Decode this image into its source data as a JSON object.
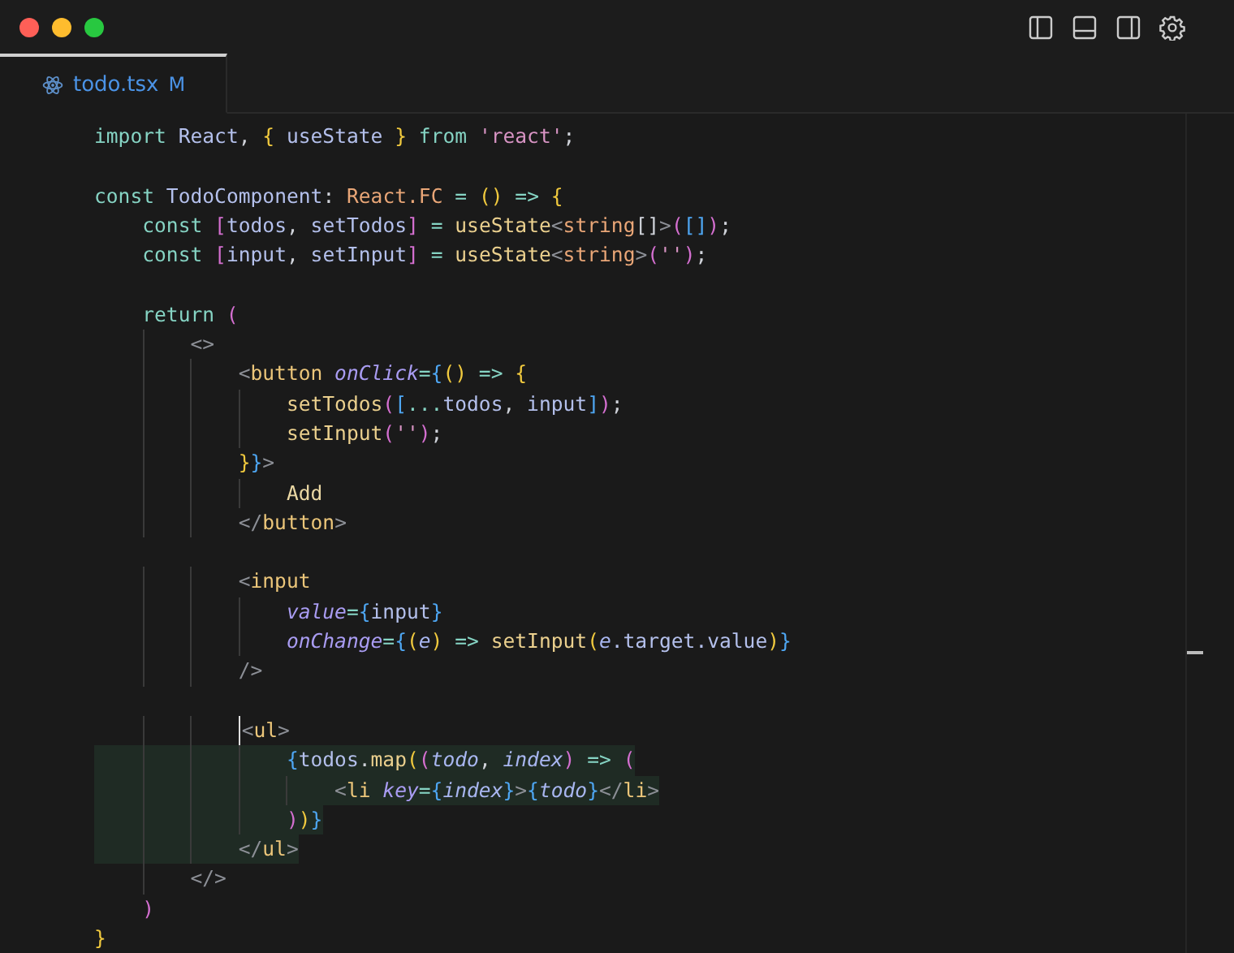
{
  "tabs": [
    {
      "label": "todo.tsx",
      "badge": "M",
      "selected": true
    }
  ],
  "editor": {
    "lines": [
      {
        "kind": "code",
        "tokens": [
          {
            "kind": "kw",
            "text": "import"
          },
          {
            "kind": "var",
            "text": " React"
          },
          {
            "kind": "plain",
            "text": ", "
          },
          {
            "kind": "p1",
            "text": "{"
          },
          {
            "kind": "var",
            "text": " useState "
          },
          {
            "kind": "p1",
            "text": "}"
          },
          {
            "kind": "kw",
            "text": " from "
          },
          {
            "kind": "str",
            "text": "'react'"
          },
          {
            "kind": "plain",
            "text": ";"
          }
        ]
      },
      {
        "kind": "blank"
      },
      {
        "kind": "code",
        "tokens": [
          {
            "kind": "kw",
            "text": "const"
          },
          {
            "kind": "var",
            "text": " TodoComponent"
          },
          {
            "kind": "plain",
            "text": ": "
          },
          {
            "kind": "type",
            "text": "React.FC"
          },
          {
            "kind": "op",
            "text": " = "
          },
          {
            "kind": "p1",
            "text": "()"
          },
          {
            "kind": "op",
            "text": " => "
          },
          {
            "kind": "p1",
            "text": "{"
          }
        ]
      },
      {
        "kind": "code",
        "tokens": [
          {
            "kind": "kw",
            "text": "    const"
          },
          {
            "kind": "p2",
            "text": " ["
          },
          {
            "kind": "var",
            "text": "todos"
          },
          {
            "kind": "plain",
            "text": ", "
          },
          {
            "kind": "var",
            "text": "setTodos"
          },
          {
            "kind": "p2",
            "text": "]"
          },
          {
            "kind": "op",
            "text": " = "
          },
          {
            "kind": "fn",
            "text": "useState"
          },
          {
            "kind": "punct",
            "text": "<"
          },
          {
            "kind": "type",
            "text": "string"
          },
          {
            "kind": "plain",
            "text": "[]"
          },
          {
            "kind": "punct",
            "text": ">"
          },
          {
            "kind": "p2",
            "text": "("
          },
          {
            "kind": "p3",
            "text": "[]"
          },
          {
            "kind": "p2",
            "text": ")"
          },
          {
            "kind": "plain",
            "text": ";"
          }
        ]
      },
      {
        "kind": "code",
        "tokens": [
          {
            "kind": "kw",
            "text": "    const"
          },
          {
            "kind": "p2",
            "text": " ["
          },
          {
            "kind": "var",
            "text": "input"
          },
          {
            "kind": "plain",
            "text": ", "
          },
          {
            "kind": "var",
            "text": "setInput"
          },
          {
            "kind": "p2",
            "text": "]"
          },
          {
            "kind": "op",
            "text": " = "
          },
          {
            "kind": "fn",
            "text": "useState"
          },
          {
            "kind": "punct",
            "text": "<"
          },
          {
            "kind": "type",
            "text": "string"
          },
          {
            "kind": "punct",
            "text": ">"
          },
          {
            "kind": "p2",
            "text": "("
          },
          {
            "kind": "str",
            "text": "''"
          },
          {
            "kind": "p2",
            "text": ")"
          },
          {
            "kind": "plain",
            "text": ";"
          }
        ]
      },
      {
        "kind": "blank"
      },
      {
        "kind": "code",
        "tokens": [
          {
            "kind": "kw",
            "text": "    return"
          },
          {
            "kind": "p2",
            "text": " ("
          }
        ]
      },
      {
        "kind": "code",
        "tokens": [
          {
            "kind": "punct",
            "text": "        <>"
          }
        ]
      },
      {
        "kind": "code",
        "tokens": [
          {
            "kind": "punct",
            "text": "            <"
          },
          {
            "kind": "tag",
            "text": "button"
          },
          {
            "kind": "attr",
            "text": " onClick"
          },
          {
            "kind": "op",
            "text": "="
          },
          {
            "kind": "p3",
            "text": "{"
          },
          {
            "kind": "p1",
            "text": "()"
          },
          {
            "kind": "op",
            "text": " => "
          },
          {
            "kind": "p1",
            "text": "{"
          }
        ]
      },
      {
        "kind": "code",
        "tokens": [
          {
            "kind": "fn",
            "text": "                setTodos"
          },
          {
            "kind": "p2",
            "text": "("
          },
          {
            "kind": "p3",
            "text": "["
          },
          {
            "kind": "op",
            "text": "..."
          },
          {
            "kind": "var",
            "text": "todos"
          },
          {
            "kind": "plain",
            "text": ", "
          },
          {
            "kind": "var",
            "text": "input"
          },
          {
            "kind": "p3",
            "text": "]"
          },
          {
            "kind": "p2",
            "text": ")"
          },
          {
            "kind": "plain",
            "text": ";"
          }
        ]
      },
      {
        "kind": "code",
        "tokens": [
          {
            "kind": "fn",
            "text": "                setInput"
          },
          {
            "kind": "p2",
            "text": "("
          },
          {
            "kind": "str",
            "text": "''"
          },
          {
            "kind": "p2",
            "text": ")"
          },
          {
            "kind": "plain",
            "text": ";"
          }
        ]
      },
      {
        "kind": "code",
        "tokens": [
          {
            "kind": "p1",
            "text": "            }"
          },
          {
            "kind": "p3",
            "text": "}"
          },
          {
            "kind": "punct",
            "text": ">"
          }
        ]
      },
      {
        "kind": "code",
        "tokens": [
          {
            "kind": "text",
            "text": "                Add"
          }
        ]
      },
      {
        "kind": "code",
        "tokens": [
          {
            "kind": "punct",
            "text": "            </"
          },
          {
            "kind": "tag",
            "text": "button"
          },
          {
            "kind": "punct",
            "text": ">"
          }
        ]
      },
      {
        "kind": "blank"
      },
      {
        "kind": "code",
        "tokens": [
          {
            "kind": "punct",
            "text": "            <"
          },
          {
            "kind": "tag",
            "text": "input"
          }
        ]
      },
      {
        "kind": "code",
        "tokens": [
          {
            "kind": "attr",
            "text": "                value"
          },
          {
            "kind": "op",
            "text": "="
          },
          {
            "kind": "p3",
            "text": "{"
          },
          {
            "kind": "var",
            "text": "input"
          },
          {
            "kind": "p3",
            "text": "}"
          }
        ]
      },
      {
        "kind": "code",
        "tokens": [
          {
            "kind": "attr",
            "text": "                onChange"
          },
          {
            "kind": "op",
            "text": "="
          },
          {
            "kind": "p3",
            "text": "{"
          },
          {
            "kind": "p1",
            "text": "("
          },
          {
            "kind": "param",
            "text": "e"
          },
          {
            "kind": "p1",
            "text": ")"
          },
          {
            "kind": "op",
            "text": " => "
          },
          {
            "kind": "fn",
            "text": "setInput"
          },
          {
            "kind": "p1",
            "text": "("
          },
          {
            "kind": "param",
            "text": "e"
          },
          {
            "kind": "var",
            "text": ".target.value"
          },
          {
            "kind": "p1",
            "text": ")"
          },
          {
            "kind": "p3",
            "text": "}"
          }
        ]
      },
      {
        "kind": "code",
        "tokens": [
          {
            "kind": "punct",
            "text": "            />"
          }
        ]
      },
      {
        "kind": "blank"
      },
      {
        "kind": "code",
        "cursor": true,
        "tokens": [
          {
            "kind": "punct",
            "text": "            <"
          },
          {
            "kind": "tag",
            "text": "ul"
          },
          {
            "kind": "punct",
            "text": ">"
          }
        ]
      },
      {
        "kind": "code",
        "selected": true,
        "tokens": [
          {
            "kind": "p3",
            "text": "                {"
          },
          {
            "kind": "var",
            "text": "todos"
          },
          {
            "kind": "plain",
            "text": "."
          },
          {
            "kind": "fn",
            "text": "map"
          },
          {
            "kind": "p1",
            "text": "("
          },
          {
            "kind": "p2",
            "text": "("
          },
          {
            "kind": "param",
            "text": "todo"
          },
          {
            "kind": "plain",
            "text": ", "
          },
          {
            "kind": "param",
            "text": "index"
          },
          {
            "kind": "p2",
            "text": ")"
          },
          {
            "kind": "op",
            "text": " => "
          },
          {
            "kind": "p2",
            "text": "("
          }
        ]
      },
      {
        "kind": "code",
        "selected": true,
        "tokens": [
          {
            "kind": "punct",
            "text": "                    <"
          },
          {
            "kind": "tag",
            "text": "li"
          },
          {
            "kind": "attr",
            "text": " key"
          },
          {
            "kind": "op",
            "text": "="
          },
          {
            "kind": "p3",
            "text": "{"
          },
          {
            "kind": "param",
            "text": "index"
          },
          {
            "kind": "p3",
            "text": "}"
          },
          {
            "kind": "punct",
            "text": ">"
          },
          {
            "kind": "p3",
            "text": "{"
          },
          {
            "kind": "param",
            "text": "todo"
          },
          {
            "kind": "p3",
            "text": "}"
          },
          {
            "kind": "punct",
            "text": "</"
          },
          {
            "kind": "tag",
            "text": "li"
          },
          {
            "kind": "punct",
            "text": ">"
          }
        ]
      },
      {
        "kind": "code",
        "selected": true,
        "tokens": [
          {
            "kind": "p2",
            "text": "                )"
          },
          {
            "kind": "p1",
            "text": ")"
          },
          {
            "kind": "p3",
            "text": "}"
          }
        ]
      },
      {
        "kind": "code",
        "selected": true,
        "tokens": [
          {
            "kind": "punct",
            "text": "            </"
          },
          {
            "kind": "tag",
            "text": "ul"
          },
          {
            "kind": "punct",
            "text": ">"
          }
        ]
      },
      {
        "kind": "code",
        "tokens": [
          {
            "kind": "punct",
            "text": "        </>"
          }
        ]
      },
      {
        "kind": "code",
        "tokens": [
          {
            "kind": "p2",
            "text": "    )"
          }
        ]
      },
      {
        "kind": "code",
        "tokens": [
          {
            "kind": "p1",
            "text": "}"
          }
        ]
      }
    ]
  }
}
